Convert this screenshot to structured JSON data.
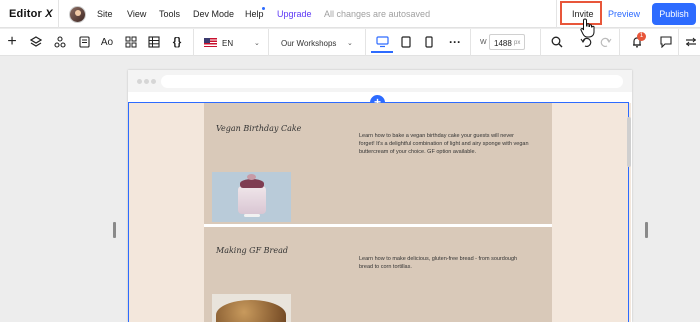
{
  "app": {
    "logo_text": "Editor",
    "logo_mark": "X"
  },
  "topbar": {
    "menu": [
      "Site",
      "View",
      "Tools",
      "Dev Mode",
      "Help"
    ],
    "upgrade_label": "Upgrade",
    "autosave_status": "All changes are autosaved",
    "invite_label": "Invite",
    "preview_label": "Preview",
    "publish_label": "Publish",
    "colors": {
      "accent": "#2d6bff",
      "upgrade": "#5d39f5",
      "highlight": "#e8563a"
    }
  },
  "toolbar": {
    "add_icon": "plus-icon",
    "language": {
      "flag": "us-flag-icon",
      "code": "EN"
    },
    "page_select": "Our Workshops",
    "width_label": "W",
    "width_value": "1488",
    "width_unit": "px",
    "notification_count": "1",
    "icons": [
      "layers-icon",
      "components-icon",
      "pages-icon",
      "typography-icon",
      "apps-grid-icon",
      "table-icon",
      "code-icon",
      "desktop-icon",
      "tablet-icon",
      "mobile-icon",
      "more-icon",
      "zoom-icon",
      "undo-icon",
      "redo-icon",
      "bell-icon",
      "comments-icon",
      "settings-icon"
    ]
  },
  "site": {
    "workshops": [
      {
        "title": "Vegan Birthday Cake",
        "description": "Learn how to bake a vegan birthday cake your guests will never forget! It's a delightful combination of light and airy sponge with vegan buttercream of your choice. GF option available.",
        "image": "cake-photo"
      },
      {
        "title": "Making GF Bread",
        "description": "Learn how to make delicious, gluten-free bread - from sourdough bread to corn tortillas.",
        "image": "bread-photo"
      }
    ]
  }
}
